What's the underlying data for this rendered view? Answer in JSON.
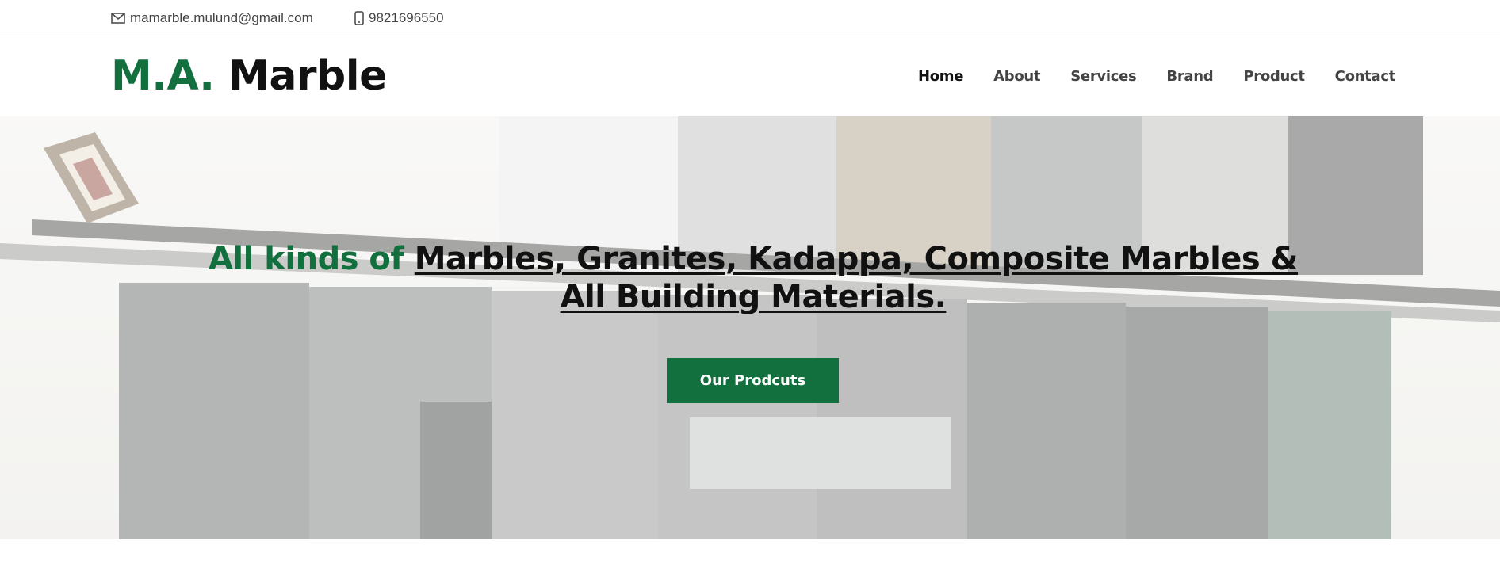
{
  "topbar": {
    "email": "mamarble.mulund@gmail.com",
    "email_icon": "envelope-icon",
    "phone": "9821696550",
    "phone_icon": "mobile-phone-icon"
  },
  "header": {
    "logo_accent": "M.A.",
    "logo_main": "Marble",
    "nav": [
      {
        "label": "Home",
        "active": true
      },
      {
        "label": "About"
      },
      {
        "label": "Services"
      },
      {
        "label": "Brand"
      },
      {
        "label": "Product"
      },
      {
        "label": "Contact"
      }
    ]
  },
  "hero": {
    "headline_prefix": "All kinds of",
    "headline_line1": "Marbles, Granites, Kadappa, Composite Marbles &",
    "headline_line2": "All Building Materials.",
    "cta_label": "Our Prodcuts"
  },
  "colors": {
    "brand_green": "#12703f",
    "text_dark": "#111111",
    "text_muted": "#444444"
  }
}
